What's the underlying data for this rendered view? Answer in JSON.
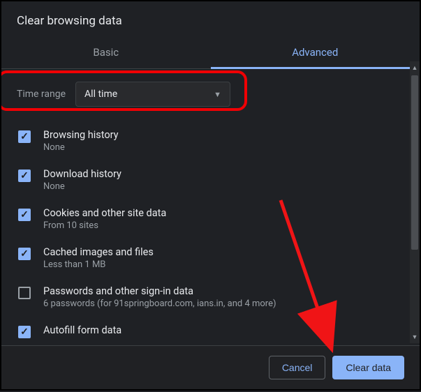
{
  "dialog": {
    "title": "Clear browsing data",
    "tabs": {
      "basic": "Basic",
      "advanced": "Advanced"
    },
    "time": {
      "label": "Time range",
      "value": "All time"
    },
    "items": [
      {
        "title": "Browsing history",
        "sub": "None",
        "checked": true
      },
      {
        "title": "Download history",
        "sub": "None",
        "checked": true
      },
      {
        "title": "Cookies and other site data",
        "sub": "From 10 sites",
        "checked": true
      },
      {
        "title": "Cached images and files",
        "sub": "Less than 1 MB",
        "checked": true
      },
      {
        "title": "Passwords and other sign-in data",
        "sub": "6 passwords (for 91springboard.com, ians.in, and 4 more)",
        "checked": false
      },
      {
        "title": "Autofill form data",
        "sub": "",
        "checked": true
      }
    ],
    "buttons": {
      "cancel": "Cancel",
      "clear": "Clear data"
    }
  },
  "annotation": {
    "highlight_color": "#f00004",
    "arrow_color": "#f01416"
  }
}
